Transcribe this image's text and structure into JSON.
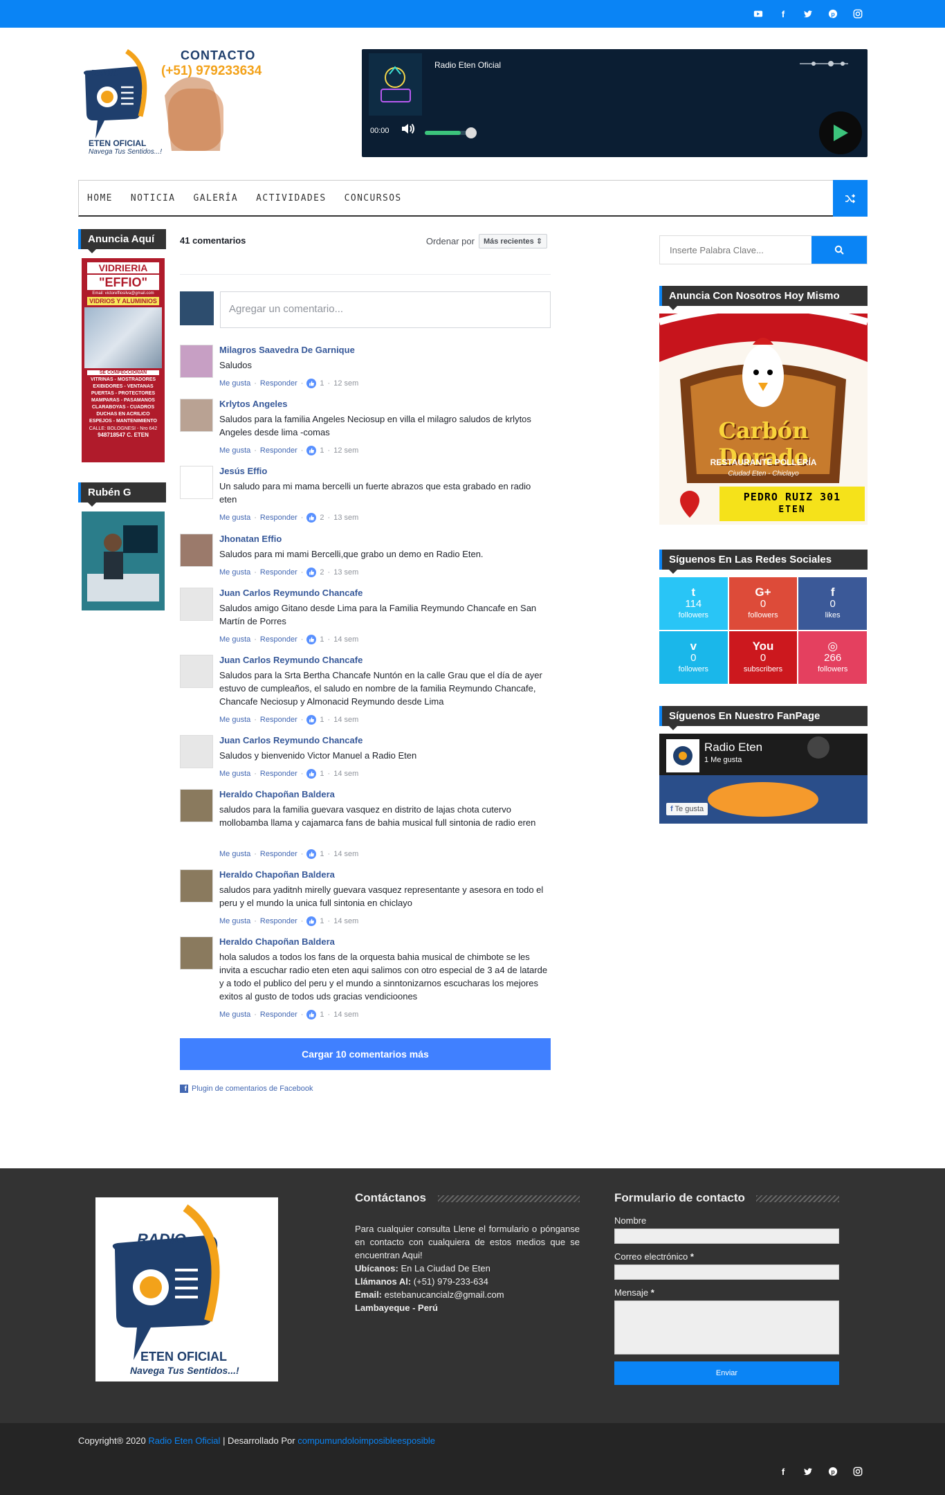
{
  "topbar": {
    "icons": [
      "youtube-icon",
      "facebook-icon",
      "twitter-icon",
      "pinterest-icon",
      "instagram-icon"
    ]
  },
  "header": {
    "contact_label": "CONTACTO",
    "contact_phone": "(+51) 979233634",
    "logo_text_1": "RADIO",
    "logo_text_2": "ETEN OFICIAL",
    "logo_slogan": "Navega Tus Sentidos...!",
    "player": {
      "title": "Radio Eten Oficial",
      "time": "00:00",
      "volume_level": 0.7
    }
  },
  "nav": {
    "items": [
      "HOME",
      "NOTICIA",
      "GALERÍA",
      "ACTIVIDADES",
      "CONCURSOS"
    ]
  },
  "left": {
    "widget1_title": "Anuncia Aquí",
    "ad1": {
      "line1": "VIDRIERIA",
      "line2": "\"EFFIO\"",
      "line3": "VIDRIOS Y ALUMINIOS",
      "email": "Email: victoreffiosilva@gmail.com",
      "sub": "SE CONFECCIONAN",
      "items": "VITRINAS - MOSTRADORES EXIBIDORES - VENTANAS PUERTAS - PROTECTORES MAMPARAS - PASAMANOS CLARABOYAS - CUADROS DUCHAS EN ACRILICO ESPEJOS - MANTENIMIENTO",
      "addr": "CALLE: BOLOGNESI - Nro 642",
      "phone": "948718547   C. ETEN"
    },
    "widget2_title": "Rubén G"
  },
  "comments": {
    "count": "41 comentarios",
    "order_label": "Ordenar por",
    "order_value": "Más recientes",
    "input_placeholder": "Agregar un comentario...",
    "like": "Me gusta",
    "reply": "Responder",
    "items": [
      {
        "name": "Milagros Saavedra De Garnique",
        "text": "Saludos",
        "likes": "1",
        "time": "12 sem"
      },
      {
        "name": "Krlytos Angeles",
        "text": "Saludos para la familia Angeles Neciosup en villa el milagro saludos de krlytos Angeles desde lima -comas",
        "likes": "1",
        "time": "12 sem"
      },
      {
        "name": "Jesús Effio",
        "text": "Un saludo para mi mama bercelli un fuerte abrazos que esta grabado en radio eten",
        "likes": "2",
        "time": "13 sem"
      },
      {
        "name": "Jhonatan Effio",
        "text": "Saludos para mi mami Bercelli,que grabo un demo en Radio Eten.",
        "likes": "2",
        "time": "13 sem"
      },
      {
        "name": "Juan Carlos Reymundo Chancafe",
        "text": "Saludos amigo Gitano desde Lima para la Familia Reymundo Chancafe en San Martín de Porres",
        "likes": "1",
        "time": "14 sem"
      },
      {
        "name": "Juan Carlos Reymundo Chancafe",
        "text": "Saludos para la Srta Bertha Chancafe Nuntón en la calle Grau que el día de ayer estuvo de cumpleaños, el saludo en nombre de la familia Reymundo Chancafe, Chancafe Neciosup y Almonacid Reymundo desde Lima",
        "likes": "1",
        "time": "14 sem"
      },
      {
        "name": "Juan Carlos Reymundo Chancafe",
        "text": "Saludos y bienvenido Victor Manuel a Radio Eten",
        "likes": "1",
        "time": "14 sem"
      },
      {
        "name": "Heraldo Chapoñan Baldera",
        "text": "saludos para la familia guevara vasquez en distrito de lajas chota cutervo mollobamba llama y cajamarca fans de bahia musical full sintonia de radio eren",
        "likes": "1",
        "time": "14 sem"
      },
      {
        "name": "Heraldo Chapoñan Baldera",
        "text": "saludos para yaditnh mirelly guevara vasquez representante y asesora en todo el peru y el mundo la unica full sintonia en chiclayo",
        "likes": "1",
        "time": "14 sem"
      },
      {
        "name": "Heraldo Chapoñan Baldera",
        "text": "hola saludos a todos los fans de la orquesta bahia musical de chimbote se les invita a escuchar radio eten eten aqui salimos con otro especial de 3 a4 de latarde y a todo el publico del peru y el mundo a sinntonizarnos escucharas los mejores exitos al gusto de todos uds gracias vendicioones",
        "likes": "1",
        "time": "14 sem"
      }
    ],
    "load_more": "Cargar 10 comentarios más",
    "plugin": "Plugin de comentarios de Facebook"
  },
  "right": {
    "search_placeholder": "Inserte Palabra Clave...",
    "ad_title": "Anuncia Con Nosotros Hoy Mismo",
    "ad": {
      "brand": "Carbón Dorado",
      "sub": "RESTAURANTE POLLERÍA",
      "city": "Ciudad Eten - Chiclayo",
      "addr1": "PEDRO RUIZ 301",
      "addr2": "ETEN"
    },
    "social_title": "Síguenos En Las Redes Sociales",
    "social": [
      {
        "icon": "twitter-icon",
        "glyph": "t",
        "count": "114",
        "label": "followers",
        "color": "#29c5f6"
      },
      {
        "icon": "google-plus-icon",
        "glyph": "G+",
        "count": "0",
        "label": "followers",
        "color": "#dd4b39"
      },
      {
        "icon": "facebook-icon",
        "glyph": "f",
        "count": "0",
        "label": "likes",
        "color": "#3b5998"
      },
      {
        "icon": "vimeo-icon",
        "glyph": "v",
        "count": "0",
        "label": "followers",
        "color": "#1ab7ea"
      },
      {
        "icon": "youtube-icon",
        "glyph": "You",
        "count": "0",
        "label": "subscribers",
        "color": "#cc181e"
      },
      {
        "icon": "instagram-icon",
        "glyph": "◎",
        "count": "266",
        "label": "followers",
        "color": "#e4405f"
      }
    ],
    "fanpage_title": "Síguenos En Nuestro FanPage",
    "fanpage": {
      "name": "Radio Eten",
      "likes": "1 Me gusta",
      "btn": "Te gusta"
    }
  },
  "footer": {
    "contact_title": "Contáctanos",
    "contact_text": "Para cualquier consulta Llene el formulario o pónganse en contacto con cualquiera de estos medios que se encuentran Aqui!",
    "loc_label": "Ubícanos:",
    "loc_value": "En La Ciudad De Eten",
    "call_label": "Llámanos Al:",
    "call_value": "(+51) 979-233-634",
    "email_label": "Email:",
    "email_value": "estebanucancialz@gmail.com",
    "region": "Lambayeque - Perú",
    "form_title": "Formulario de contacto",
    "f_name": "Nombre",
    "f_email": "Correo electrónico",
    "f_msg": "Mensaje",
    "required": "*",
    "send": "Enviar"
  },
  "bottom": {
    "copy_pre": "Copyright® 2020",
    "copy_site": "Radio Eten Oficial",
    "copy_mid": "| Desarrollado Por",
    "copy_dev": "compumundoloimposibleesposible"
  }
}
